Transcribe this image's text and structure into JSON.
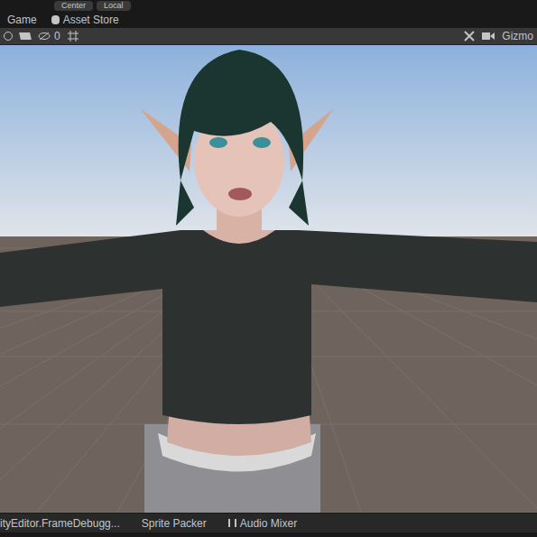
{
  "top_toolbar": {
    "buttons": [
      {
        "label": "Center"
      },
      {
        "label": "Local"
      }
    ]
  },
  "tabs": [
    {
      "label": "Game",
      "selected": false
    },
    {
      "label": "Asset Store",
      "selected": false
    }
  ],
  "scene_toolbar": {
    "hidden_count": "0",
    "gizmos_label": "Gizmo"
  },
  "bottom_tabs": [
    {
      "label": "ityEditor.FrameDebugg..."
    },
    {
      "label": "Sprite Packer"
    },
    {
      "label": "Audio Mixer"
    }
  ]
}
